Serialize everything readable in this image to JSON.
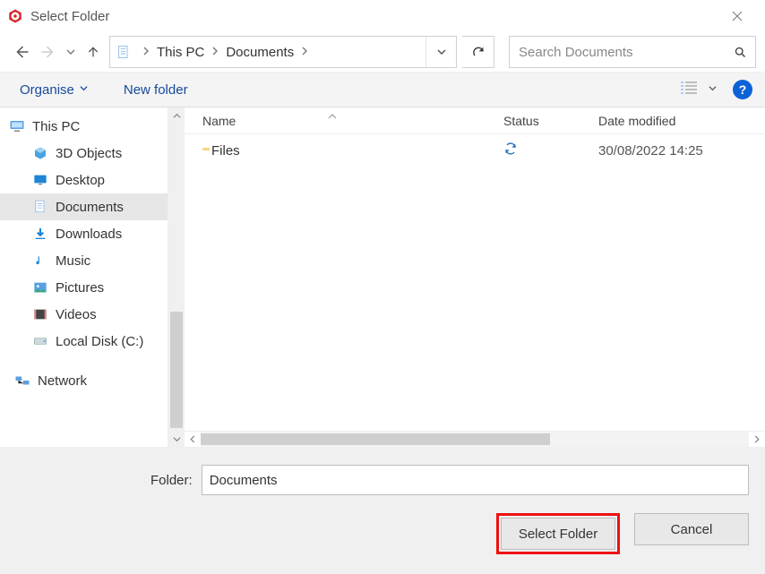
{
  "window": {
    "title": "Select Folder"
  },
  "address": {
    "segments": [
      "This PC",
      "Documents"
    ]
  },
  "search": {
    "placeholder": "Search Documents"
  },
  "toolbar": {
    "organise_label": "Organise",
    "new_folder_label": "New folder"
  },
  "sidebar": {
    "root_thispc": "This PC",
    "items": [
      {
        "label": "3D Objects"
      },
      {
        "label": "Desktop"
      },
      {
        "label": "Documents"
      },
      {
        "label": "Downloads"
      },
      {
        "label": "Music"
      },
      {
        "label": "Pictures"
      },
      {
        "label": "Videos"
      },
      {
        "label": "Local Disk (C:)"
      }
    ],
    "root_network": "Network"
  },
  "columns": {
    "name": "Name",
    "status": "Status",
    "date": "Date modified"
  },
  "rows": [
    {
      "name": "Files",
      "status": "sync",
      "date": "30/08/2022 14:25"
    }
  ],
  "footer": {
    "folder_label": "Folder:",
    "folder_value": "Documents",
    "select_label": "Select Folder",
    "cancel_label": "Cancel"
  }
}
